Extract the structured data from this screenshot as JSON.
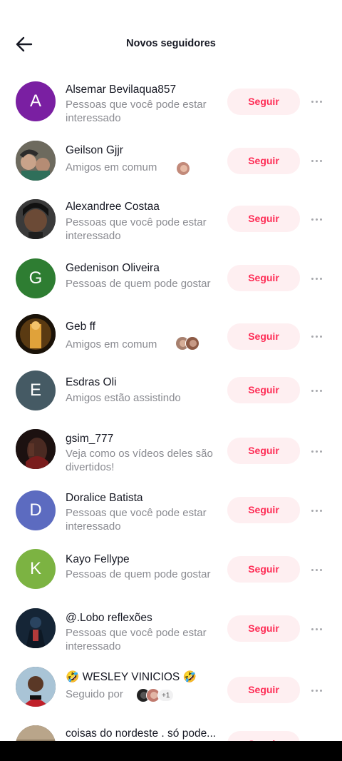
{
  "header": {
    "title": "Novos seguidores"
  },
  "follow_label": "Seguir",
  "rows": [
    {
      "name": "Alsemar Bevilaqua857",
      "sub": "Pessoas que você pode estar interessado",
      "avatar_letter": "A",
      "avatar_color": "#7a1fa2"
    },
    {
      "name": "Geilson Gjjr",
      "sub": "Amigos em comum"
    },
    {
      "name": "Alexandree Costaa",
      "sub": "Pessoas que você pode estar interessado"
    },
    {
      "name": "Gedenison Oliveira",
      "sub": "Pessoas de quem pode gostar",
      "avatar_letter": "G",
      "avatar_color": "#2e7d32"
    },
    {
      "name": "Geb ff",
      "sub": "Amigos em comum"
    },
    {
      "name": "Esdras Oli",
      "sub": "Amigos estão assistindo",
      "avatar_letter": "E",
      "avatar_color": "#455a64"
    },
    {
      "name": "gsim_777",
      "sub": "Veja como os vídeos deles são divertidos!"
    },
    {
      "name": "Doralice Batista",
      "sub": "Pessoas que você pode estar interessado",
      "avatar_letter": "D",
      "avatar_color": "#5c6bc0"
    },
    {
      "name": "Kayo Fellype",
      "sub": "Pessoas de quem pode gostar",
      "avatar_letter": "K",
      "avatar_color": "#7cb342"
    },
    {
      "name": "@.Lobo reflexões",
      "sub": "Pessoas que você pode estar interessado"
    },
    {
      "name": "🤣 WESLEY VINICIOS 🤣",
      "sub": "Seguido por",
      "extra_count": "+1"
    },
    {
      "name": "coisas do nordeste . só pode..."
    }
  ]
}
